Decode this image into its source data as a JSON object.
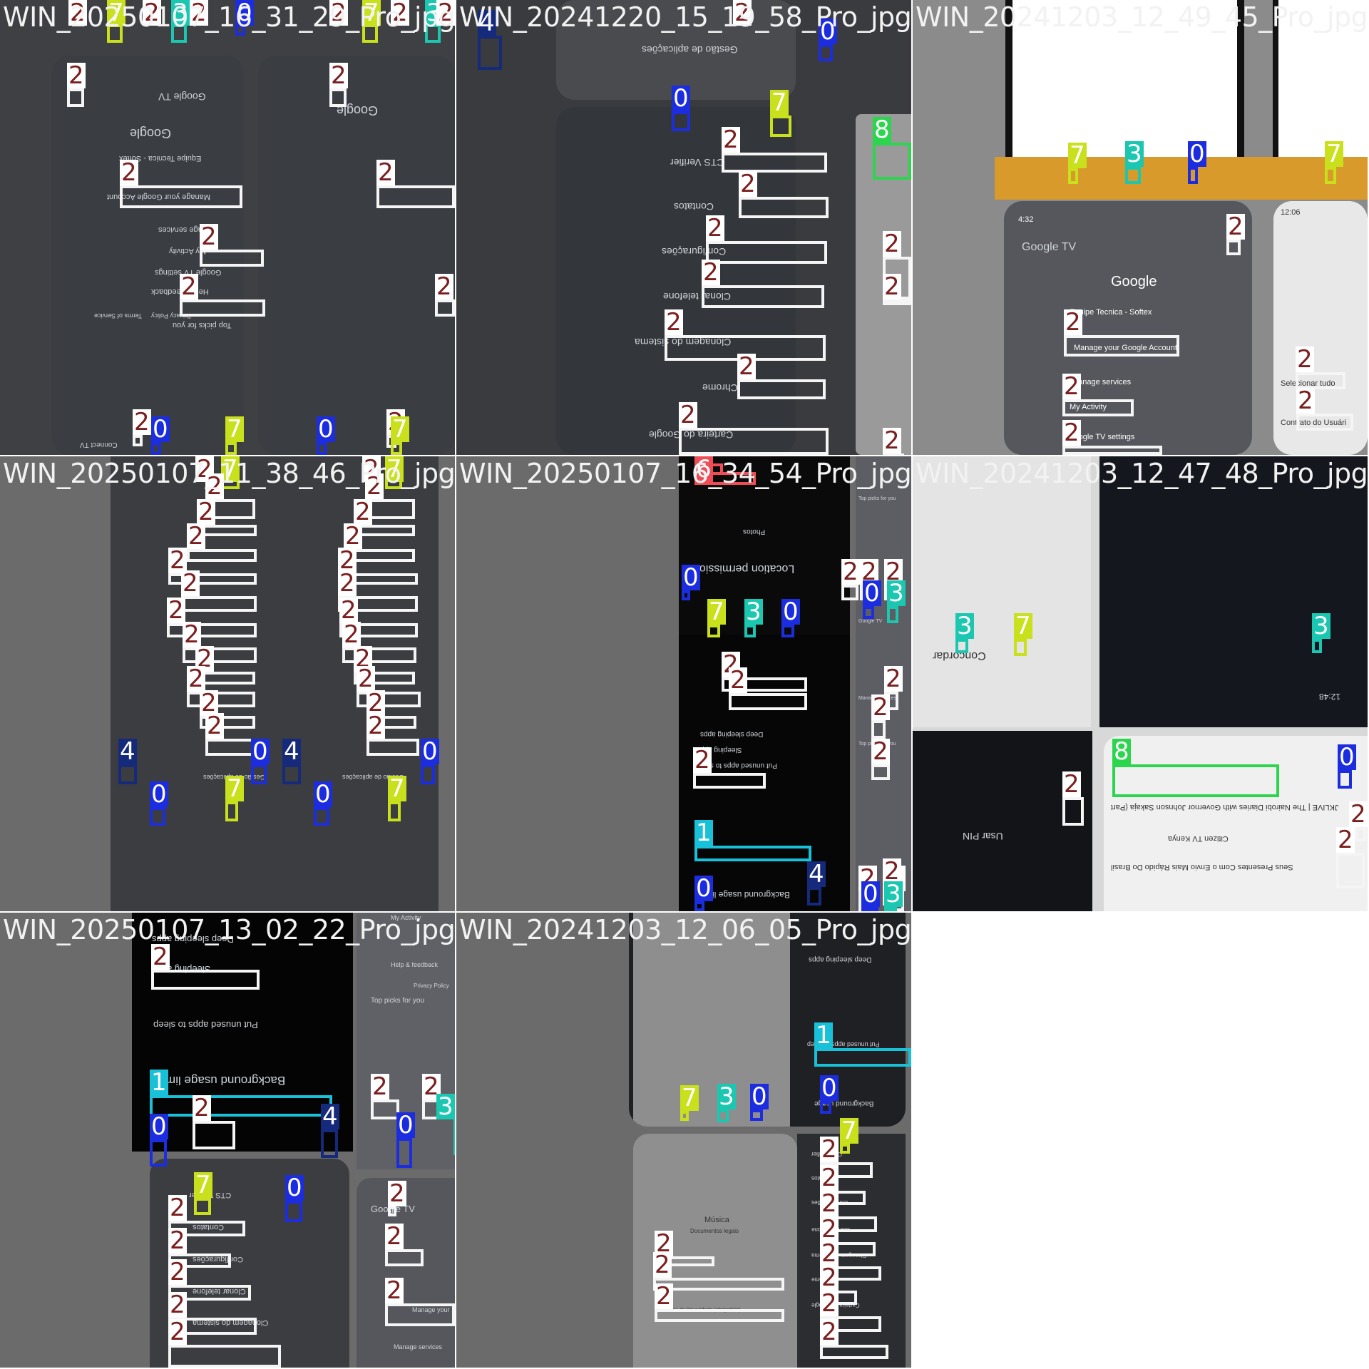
{
  "tiles": [
    {
      "filename": "WIN_20250107_16_31_29_Pro_jpg.rf.",
      "texts": [
        "Google",
        "Google TV",
        "Equipe Tecnica - Softex",
        "Manage your Google Account",
        "Manage services",
        "My Activity",
        "Google TV settings",
        "Help & feedback",
        "Privacy Policy",
        "Terms of Service",
        "Top picks for you",
        "Connect TV"
      ]
    },
    {
      "filename": "WIN_20241220_15_19_58_Pro_jpg.rf.9736",
      "texts": [
        "Gestão de aplicações",
        "CTS Verifier",
        "Contatos",
        "Configurações",
        "Clonar telefone",
        "Clonagem do sistema",
        "Chrome",
        "Carteira do Google"
      ]
    },
    {
      "filename": "WIN_20241203_12_49_45_Pro_jpg.rf.1011b2",
      "texts": [
        "Google TV",
        "Google",
        "Equipe Tecnica - Softex",
        "Manage your Google Account",
        "Manage services",
        "My Activity",
        "Google TV settings",
        "Selecionar tudo",
        "Contrato do Usuári",
        "4:32",
        "12:06"
      ]
    },
    {
      "filename": "WIN_20250107_11_38_46_Pro_jpg.rf.",
      "texts": [
        "Gestão de aplicações"
      ]
    },
    {
      "filename": "WIN_20250107_16_34_54_Pro_jpg.rf.7a0a",
      "texts": [
        "Location permission",
        "Photos",
        "Deep sleeping apps",
        "Sleeping apps",
        "Put unused apps to sleep",
        "Background usage limits",
        "Google TV",
        "Manage services",
        "Top picks for you"
      ]
    },
    {
      "filename": "WIN_20241203_12_47_48_Pro_jpg.rf.dcb25",
      "texts": [
        "Concordar",
        "Usar PIN",
        "12:48",
        "JKLIVE | The Nairobi Diaries with Governor Johnson Sakaja (Part",
        "Citizen TV Kenya",
        "Seus Presentes Com o Envio Mais Rápido Do Brasil"
      ]
    },
    {
      "filename": "WIN_20250107_13_02_22_Pro_jpg.rf.",
      "texts": [
        "Deep sleeping apps",
        "Sleeping apps",
        "Put unused apps to sleep",
        "Background usage limits",
        "CTS Verifier",
        "Contatos",
        "Configurações",
        "Clonar telefone",
        "Clonagem do sistema",
        "My Activity",
        "Help & feedback",
        "Privacy Policy",
        "Top picks for you",
        "Google TV",
        "Manage your",
        "Manage services"
      ]
    },
    {
      "filename": "WIN_20241203_12_06_05_Pro_jpg.rf.51074d3",
      "texts": [
        "Política de Privacidade (obrigatório)",
        "Música",
        "Documentos legais",
        "Deep sleeping apps",
        "Put unused apps to sleep",
        "Background usage",
        "CTS Verifier",
        "Contatos",
        "Configurações",
        "Clonar telefone",
        "Clonagem do sistema",
        "Chrome",
        "Carteira do Google"
      ]
    }
  ],
  "annotations": [
    [
      {
        "cls": "2"
      },
      {
        "cls": "7"
      },
      {
        "cls": "2"
      },
      {
        "cls": "2"
      },
      {
        "cls": "3"
      },
      {
        "cls": "0"
      },
      {
        "cls": "2"
      },
      {
        "cls": "2"
      },
      {
        "cls": "7"
      },
      {
        "cls": "3"
      },
      {
        "cls": "2"
      },
      {
        "cls": "2"
      },
      {
        "cls": "2"
      },
      {
        "cls": "2"
      },
      {
        "cls": "2"
      },
      {
        "cls": "2"
      },
      {
        "cls": "2"
      },
      {
        "cls": "2"
      },
      {
        "cls": "2"
      },
      {
        "cls": "0"
      },
      {
        "cls": "7"
      },
      {
        "cls": "0"
      },
      {
        "cls": "2"
      },
      {
        "cls": "7"
      }
    ],
    [
      {
        "cls": "4"
      },
      {
        "cls": "2"
      },
      {
        "cls": "0"
      },
      {
        "cls": "0"
      },
      {
        "cls": "7"
      },
      {
        "cls": "8"
      },
      {
        "cls": "2"
      },
      {
        "cls": "2"
      },
      {
        "cls": "2"
      },
      {
        "cls": "2"
      },
      {
        "cls": "2"
      },
      {
        "cls": "2"
      },
      {
        "cls": "2"
      },
      {
        "cls": "2"
      },
      {
        "cls": "2"
      },
      {
        "cls": "2"
      }
    ],
    [
      {
        "cls": "7"
      },
      {
        "cls": "3"
      },
      {
        "cls": "0"
      },
      {
        "cls": "7"
      },
      {
        "cls": "2"
      },
      {
        "cls": "2"
      },
      {
        "cls": "2"
      },
      {
        "cls": "2"
      },
      {
        "cls": "2"
      },
      {
        "cls": "2"
      }
    ],
    [
      {
        "cls": "2"
      },
      {
        "cls": "7"
      },
      {
        "cls": "2"
      },
      {
        "cls": "7"
      },
      {
        "cls": "2"
      },
      {
        "cls": "2"
      },
      {
        "cls": "2"
      },
      {
        "cls": "2"
      },
      {
        "cls": "2"
      },
      {
        "cls": "2"
      },
      {
        "cls": "2"
      },
      {
        "cls": "2"
      },
      {
        "cls": "2"
      },
      {
        "cls": "2"
      },
      {
        "cls": "2"
      },
      {
        "cls": "2"
      },
      {
        "cls": "2"
      },
      {
        "cls": "2"
      },
      {
        "cls": "2"
      },
      {
        "cls": "2"
      },
      {
        "cls": "2"
      },
      {
        "cls": "2"
      },
      {
        "cls": "2"
      },
      {
        "cls": "2"
      },
      {
        "cls": "2"
      },
      {
        "cls": "2"
      },
      {
        "cls": "4"
      },
      {
        "cls": "0"
      },
      {
        "cls": "4"
      },
      {
        "cls": "0"
      },
      {
        "cls": "0"
      },
      {
        "cls": "7"
      },
      {
        "cls": "0"
      },
      {
        "cls": "7"
      },
      {
        "cls": "2"
      },
      {
        "cls": "2"
      },
      {
        "cls": "2"
      },
      {
        "cls": "2"
      },
      {
        "cls": "2"
      },
      {
        "cls": "2"
      },
      {
        "cls": "2"
      },
      {
        "cls": "2"
      }
    ],
    [
      {
        "cls": "6"
      },
      {
        "cls": "6"
      },
      {
        "cls": "2"
      },
      {
        "cls": "2"
      },
      {
        "cls": "0"
      },
      {
        "cls": "7"
      },
      {
        "cls": "3"
      },
      {
        "cls": "0"
      },
      {
        "cls": "2"
      },
      {
        "cls": "2"
      },
      {
        "cls": "2"
      },
      {
        "cls": "0"
      },
      {
        "cls": "3"
      },
      {
        "cls": "2"
      },
      {
        "cls": "2"
      },
      {
        "cls": "2"
      },
      {
        "cls": "2"
      },
      {
        "cls": "1"
      },
      {
        "cls": "0"
      },
      {
        "cls": "4"
      },
      {
        "cls": "2"
      },
      {
        "cls": "2"
      },
      {
        "cls": "2"
      },
      {
        "cls": "0"
      },
      {
        "cls": "3"
      }
    ],
    [
      {
        "cls": "3"
      },
      {
        "cls": "7"
      },
      {
        "cls": "3"
      },
      {
        "cls": "8"
      },
      {
        "cls": "0"
      },
      {
        "cls": "2"
      },
      {
        "cls": "2"
      },
      {
        "cls": "2"
      }
    ],
    [
      {
        "cls": "2"
      },
      {
        "cls": "2"
      },
      {
        "cls": "1"
      },
      {
        "cls": "0"
      },
      {
        "cls": "4"
      },
      {
        "cls": "7"
      },
      {
        "cls": "0"
      },
      {
        "cls": "2"
      },
      {
        "cls": "2"
      },
      {
        "cls": "0"
      },
      {
        "cls": "3"
      },
      {
        "cls": "2"
      },
      {
        "cls": "2"
      },
      {
        "cls": "2"
      },
      {
        "cls": "2"
      },
      {
        "cls": "2"
      },
      {
        "cls": "2"
      },
      {
        "cls": "2"
      },
      {
        "cls": "2"
      }
    ],
    [
      {
        "cls": "2"
      },
      {
        "cls": "2"
      },
      {
        "cls": "2"
      },
      {
        "cls": "2"
      },
      {
        "cls": "1"
      },
      {
        "cls": "0"
      },
      {
        "cls": "7"
      },
      {
        "cls": "3"
      },
      {
        "cls": "0"
      },
      {
        "cls": "7"
      },
      {
        "cls": "0"
      },
      {
        "cls": "2"
      },
      {
        "cls": "2"
      },
      {
        "cls": "2"
      },
      {
        "cls": "2"
      },
      {
        "cls": "2"
      },
      {
        "cls": "2"
      },
      {
        "cls": "2"
      },
      {
        "cls": "2"
      },
      {
        "cls": "2"
      },
      {
        "cls": "2"
      },
      {
        "cls": "2"
      }
    ]
  ]
}
